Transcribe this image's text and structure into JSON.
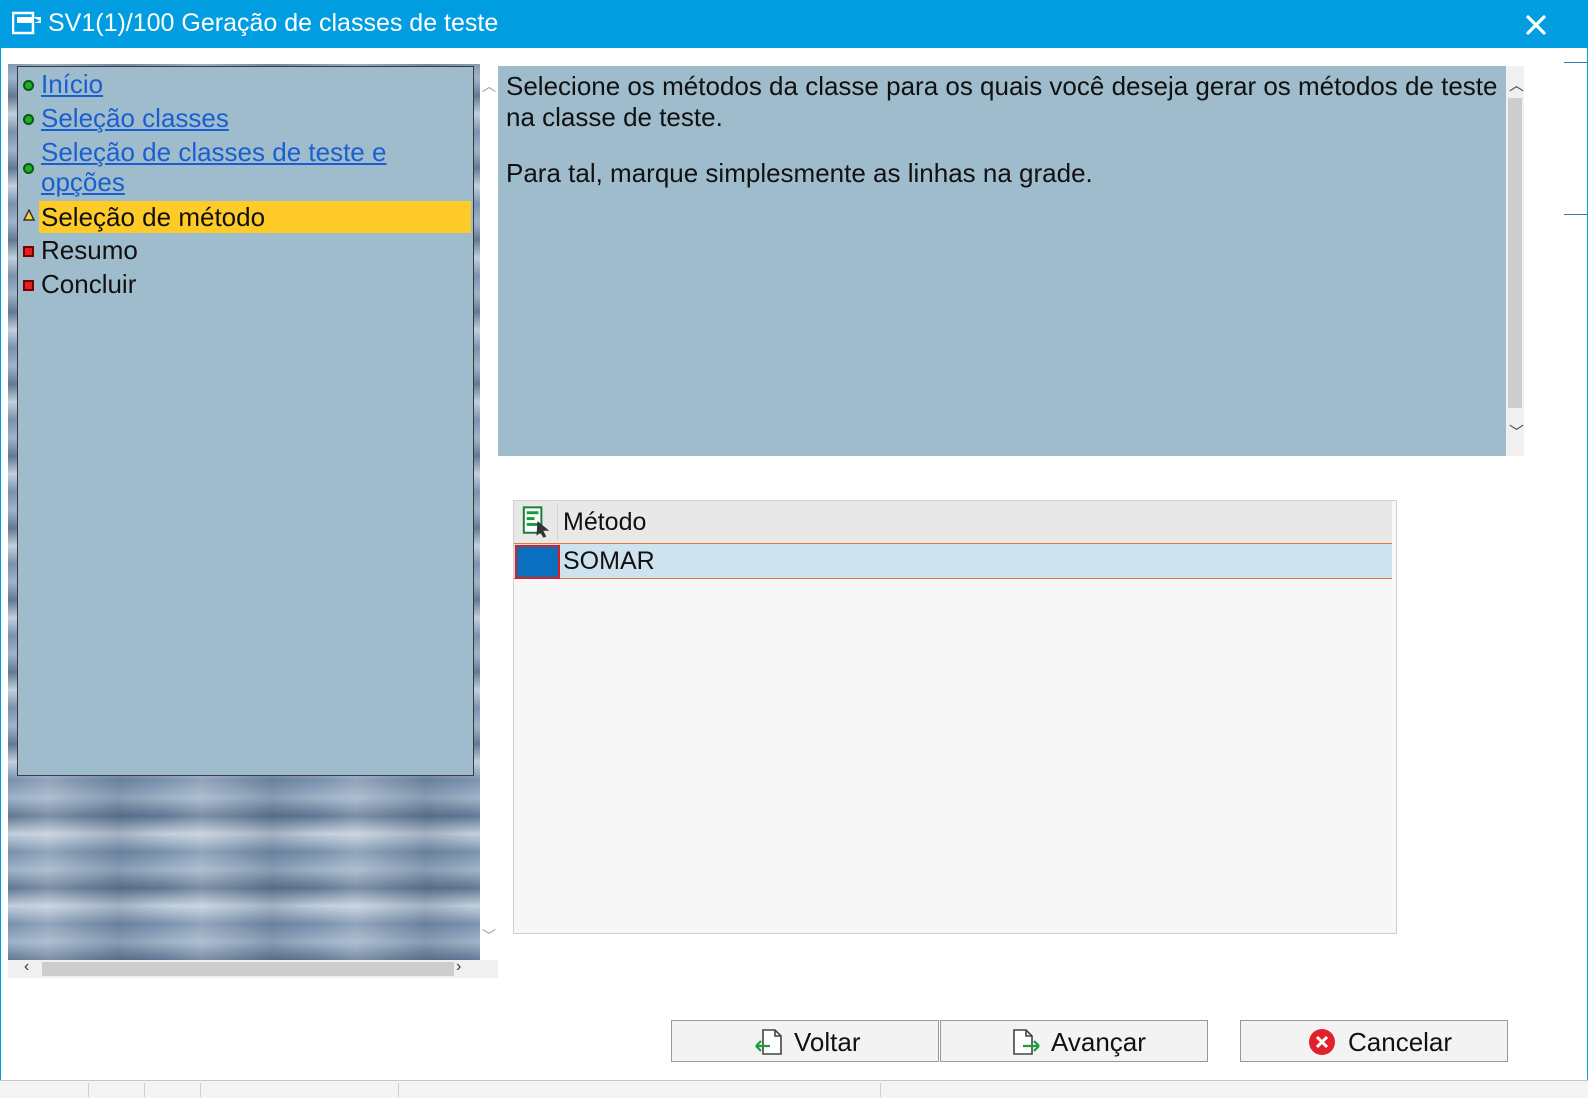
{
  "window": {
    "title": "SV1(1)/100 Geração de classes de teste"
  },
  "steps": [
    {
      "label": "Início",
      "status": "done"
    },
    {
      "label": "Seleção classes",
      "status": "done"
    },
    {
      "label": "Seleção de classes de teste e",
      "label2": "opções",
      "status": "done"
    },
    {
      "label": "Seleção de método",
      "status": "current"
    },
    {
      "label": "Resumo",
      "status": "pending"
    },
    {
      "label": "Concluir",
      "status": "pending"
    }
  ],
  "info": {
    "paragraph1": "Selecione os métodos da classe para os quais você deseja gerar os métodos de teste na classe de teste.",
    "paragraph2": "Para tal, marque simplesmente as linhas na grade."
  },
  "grid": {
    "column_header": "Método",
    "rows": [
      "SOMAR"
    ]
  },
  "buttons": {
    "back": "Voltar",
    "next": "Avançar",
    "cancel": "Cancelar"
  },
  "colors": {
    "titlebar": "#009de0",
    "panel": "#9fbccd",
    "current_step": "#ffcb29",
    "link": "#1a5fd0",
    "selected_cell": "#0a6fbf"
  },
  "icons": {
    "app": "dialog-window-icon",
    "close": "close-icon",
    "step_done": "green-dot-icon",
    "step_current": "yellow-triangle-icon",
    "step_pending": "red-square-icon",
    "grid_layout": "grid-layout-icon",
    "back": "back-arrow-icon",
    "next": "forward-arrow-icon",
    "cancel": "cancel-circle-icon"
  }
}
